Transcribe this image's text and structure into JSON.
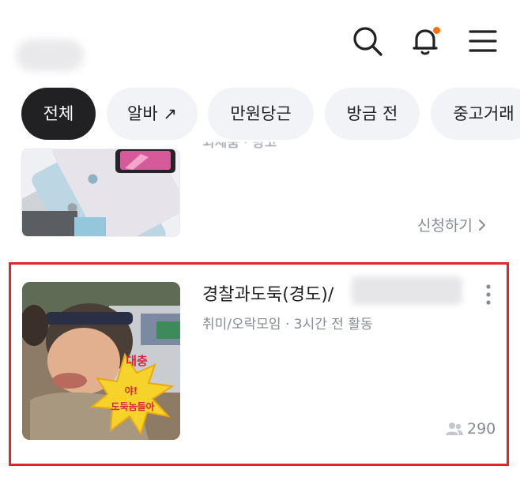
{
  "header": {
    "icons": [
      "search-icon",
      "bell-icon",
      "menu-icon"
    ],
    "notification_dot_color": "#ff6f0f"
  },
  "filter_chips": [
    {
      "label": "전체",
      "selected": true
    },
    {
      "label": "알바 ↗",
      "selected": false
    },
    {
      "label": "만원당근",
      "selected": false
    },
    {
      "label": "방금 전",
      "selected": false
    },
    {
      "label": "중고거래",
      "selected": false
    }
  ],
  "previous_card": {
    "meta_fragment": "외제품 · 광고",
    "apply_label": "신청하기",
    "apply_icon": "chevron-right-icon"
  },
  "group_card": {
    "title": "경찰과도둑(경도)/",
    "category": "취미/오락모임",
    "activity": "3시간 전 활동",
    "member_count": "290",
    "thumbnail_caption_top": "대충",
    "thumbnail_caption_line1": "야!",
    "thumbnail_caption_line2": "도둑놈들아",
    "highlight_color": "#e3242b"
  }
}
